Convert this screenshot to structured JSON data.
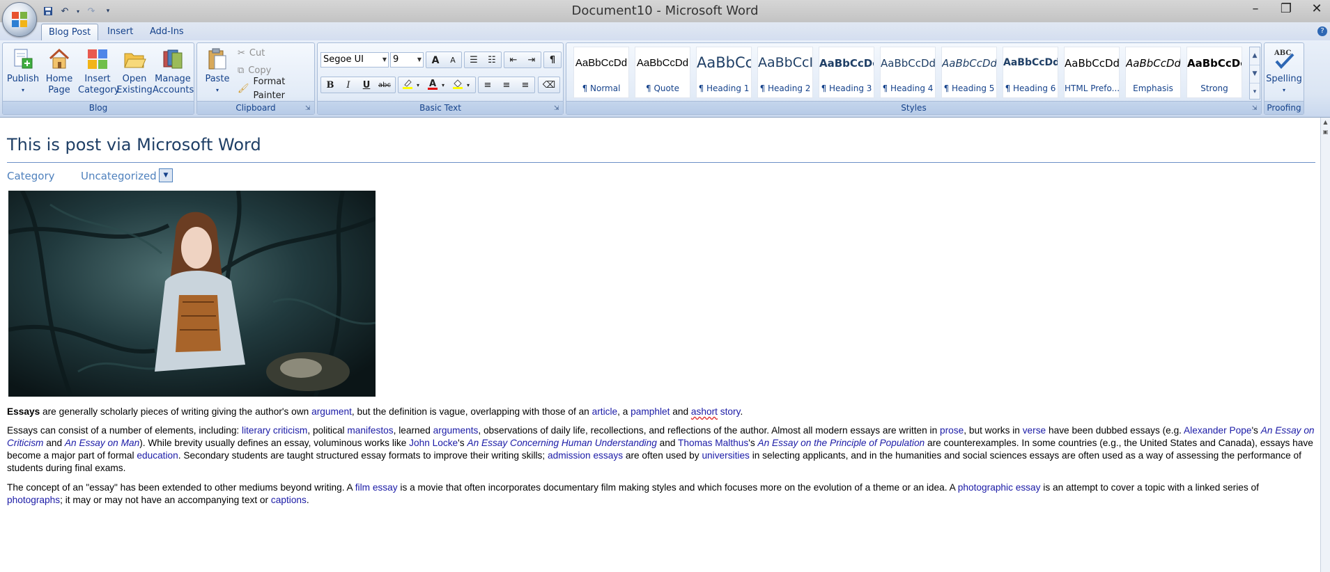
{
  "window": {
    "title": "Document10 - Microsoft Word"
  },
  "tabs": [
    {
      "label": "Blog Post",
      "active": true
    },
    {
      "label": "Insert",
      "active": false
    },
    {
      "label": "Add-Ins",
      "active": false
    }
  ],
  "ribbon": {
    "blog": {
      "label": "Blog",
      "publish": "Publish",
      "home_page_1": "Home",
      "home_page_2": "Page",
      "insert_category_1": "Insert",
      "insert_category_2": "Category",
      "open_existing_1": "Open",
      "open_existing_2": "Existing",
      "manage_accounts_1": "Manage",
      "manage_accounts_2": "Accounts"
    },
    "clipboard": {
      "label": "Clipboard",
      "paste": "Paste",
      "cut": "Cut",
      "copy": "Copy",
      "format_painter": "Format Painter"
    },
    "basic_text": {
      "label": "Basic Text",
      "font": "Segoe UI",
      "size": "9",
      "bold": "B",
      "italic": "I",
      "underline": "U",
      "strike": "abc",
      "grow": "A",
      "shrink": "A",
      "pilcrow": "¶"
    },
    "styles": {
      "label": "Styles",
      "items": [
        {
          "sample": "AaBbCcDd",
          "name": "¶ Normal"
        },
        {
          "sample": "AaBbCcDd",
          "name": "¶ Quote"
        },
        {
          "sample": "AaBbCc",
          "name": "¶ Heading 1"
        },
        {
          "sample": "AaBbCcI",
          "name": "¶ Heading 2"
        },
        {
          "sample": "AaBbCcDc",
          "name": "¶ Heading 3"
        },
        {
          "sample": "AaBbCcDd",
          "name": "¶ Heading 4"
        },
        {
          "sample": "AaBbCcDd",
          "name": "¶ Heading 5"
        },
        {
          "sample": "AaBbCcDdI",
          "name": "¶ Heading 6"
        },
        {
          "sample": "AaBbCcDdI",
          "name": "HTML Prefo..."
        },
        {
          "sample": "AaBbCcDd",
          "name": "Emphasis"
        },
        {
          "sample": "AaBbCcDc",
          "name": "Strong"
        }
      ]
    },
    "proofing": {
      "label": "Proofing",
      "spelling": "Spelling",
      "abc": "ABC"
    }
  },
  "document": {
    "title": "This is post via Microsoft Word",
    "category_label": "Category",
    "category_value": "Uncategorized",
    "paragraphs": {
      "p1": {
        "s0": "Essays",
        "s1": " are generally scholarly pieces of writing giving the author's own ",
        "l1": "argument",
        "s2": ", but the definition is vague, overlapping with those of an ",
        "l2": "article",
        "s3": ", a ",
        "l3": "pamphlet",
        "s4": " and ",
        "l4": "ashort",
        "s5": " ",
        "l5": "story",
        "s6": "."
      },
      "p2": {
        "s0": "Essays can consist of a number of elements, including: ",
        "l1": "literary criticism",
        "s1": ", political ",
        "l2": "manifestos",
        "s2": ", learned ",
        "l3": "arguments",
        "s3": ", observations of daily life, recollections, and reflections of the author. Almost all modern essays are written in ",
        "l4": "prose",
        "s4": ", but works in ",
        "l5": "verse",
        "s5": " have been dubbed essays (e.g. ",
        "l6": "Alexander Pope",
        "s6": "'s ",
        "i1": "An Essay on Criticism",
        "s7": " and ",
        "i2": "An Essay on Man",
        "s8": "). While brevity usually defines an essay, voluminous works like ",
        "l7": "John Locke",
        "s9": "'s ",
        "i3": "An Essay Concerning Human Understanding",
        "s10": " and ",
        "l8": "Thomas Malthus",
        "s11": "'s ",
        "i4": "An Essay on the Principle of Population",
        "s12": " are counterexamples. In some countries (e.g., the United States and Canada), essays have become a major part of formal ",
        "l9": "education",
        "s13": ". Secondary students are taught structured essay formats to improve their writing skills; ",
        "l10": "admission essays",
        "s14": " are often used by ",
        "l11": "universities",
        "s15": " in selecting applicants, and in the humanities and social sciences essays are often used as a way of assessing the performance of students during final exams."
      },
      "p3": {
        "s0": "The concept of an \"essay\" has been extended to other mediums beyond writing. A ",
        "l1": "film essay",
        "s1": " is a movie that often incorporates documentary film making styles and which focuses more on the evolution of a theme or an idea. A ",
        "l2": "photographic essay",
        "s2": " is an attempt to cover a topic with a linked series of ",
        "l3": "photographs",
        "s3": "; it may or may not have an accompanying text or ",
        "l4": "captions",
        "s4": "."
      }
    }
  },
  "colors": {
    "accent": "#15428b",
    "link": "#1a1aa6",
    "heading": "#1f3f66",
    "category": "#4f81bd"
  }
}
